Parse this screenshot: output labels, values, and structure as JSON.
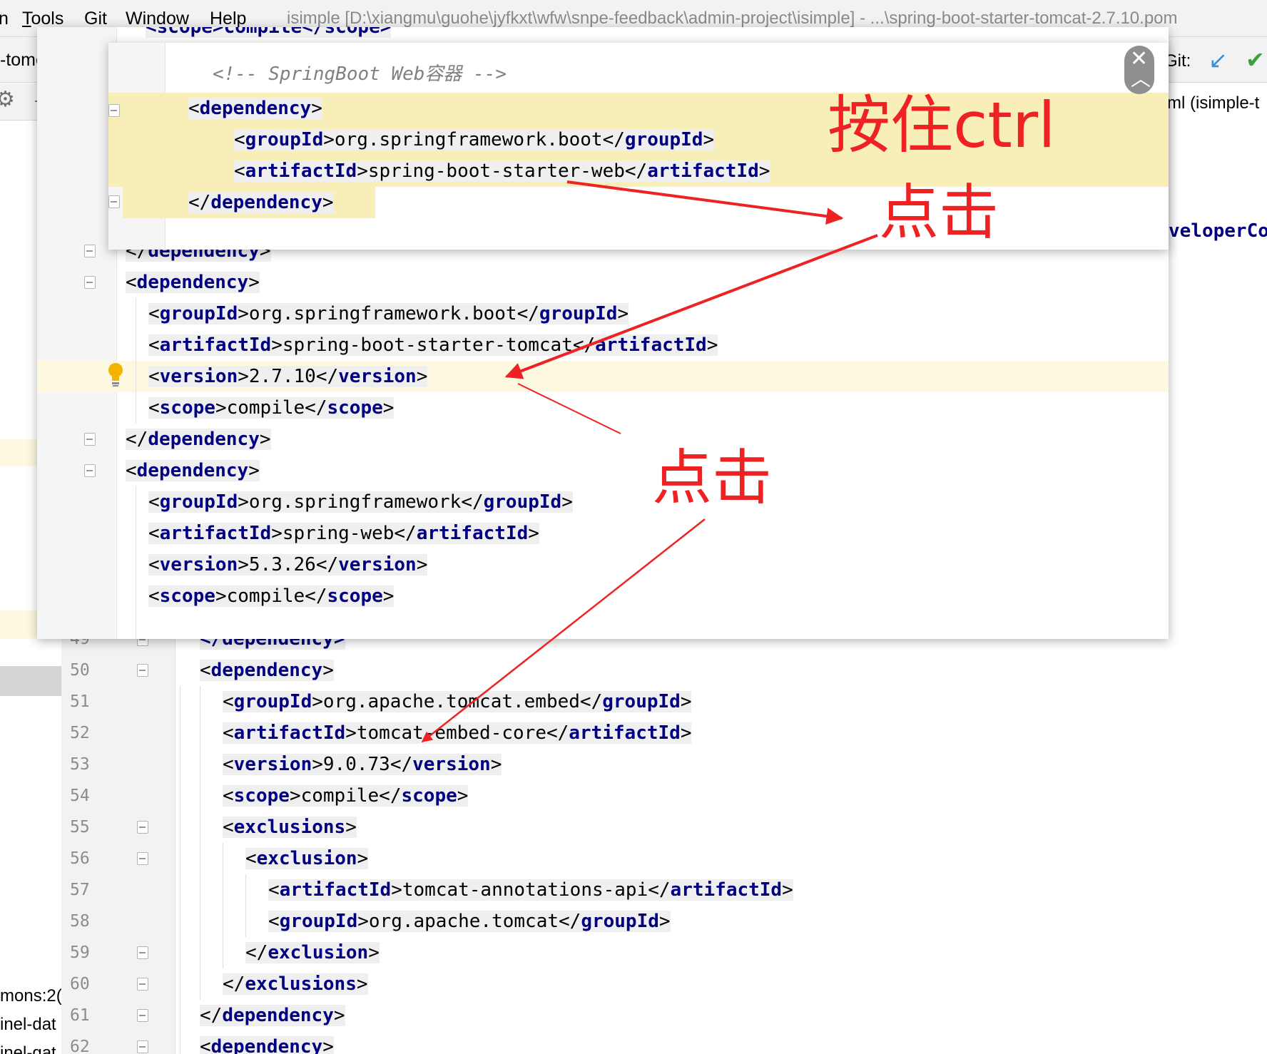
{
  "menubar": {
    "partial_item": "n",
    "items": [
      {
        "key": "tools",
        "mnemonic": "T",
        "rest": "ools"
      },
      {
        "key": "git",
        "mnemonic": "",
        "rest": "Git"
      },
      {
        "key": "window",
        "mnemonic": "",
        "rest": "Window"
      },
      {
        "key": "help",
        "mnemonic": "",
        "rest": "Help"
      }
    ],
    "window_title": "isimple [D:\\xiangmu\\guohe\\jyfkxt\\wfw\\snpe-feedback\\admin-project\\isimple] - ...\\spring-boot-starter-tomcat-2.7.10.pom"
  },
  "tabs": {
    "active_label": "-tome)",
    "close_icon": "×"
  },
  "toolbar": {
    "settings_icon": "gear-icon",
    "dash": "-"
  },
  "right_panel": {
    "git_label": "Git:",
    "git_update_icon": "checkmark-arrow-icon",
    "git_commit_icon": "checkmark-icon",
    "file_label": "ml (isimple-t",
    "code_fragment": "veloperCo"
  },
  "left_panel": {
    "fragments": [
      "mons:2(",
      "inel-dat",
      "inel-gat"
    ]
  },
  "popup1": {
    "comment": "<!-- SpringBoot Web容器 -->",
    "lines": [
      {
        "indent": 0,
        "open": "dependency",
        "text": "",
        "close": ""
      },
      {
        "indent": 1,
        "open": "groupId",
        "text": "org.springframework.boot",
        "close": "groupId"
      },
      {
        "indent": 1,
        "open": "artifactId",
        "text": "spring-boot-starter-web",
        "close": "artifactId"
      },
      {
        "indent": 0,
        "open": "",
        "text": "",
        "close": "dependency"
      }
    ]
  },
  "popup2": {
    "partial_line": "<scope>compile</scope>",
    "lines": [
      {
        "indent": 0,
        "open": "",
        "text": "",
        "close": "dependency"
      },
      {
        "indent": 0,
        "open": "dependency",
        "text": "",
        "close": ""
      },
      {
        "indent": 1,
        "open": "groupId",
        "text": "org.springframework.boot",
        "close": "groupId"
      },
      {
        "indent": 1,
        "open": "artifactId",
        "text": "spring-boot-starter-tomcat",
        "close": "artifactId"
      },
      {
        "indent": 1,
        "open": "version",
        "text": "2.7.10",
        "close": "version"
      },
      {
        "indent": 1,
        "open": "scope",
        "text": "compile",
        "close": "scope"
      },
      {
        "indent": 0,
        "open": "",
        "text": "",
        "close": "dependency"
      },
      {
        "indent": 0,
        "open": "dependency",
        "text": "",
        "close": ""
      },
      {
        "indent": 1,
        "open": "groupId",
        "text": "org.springframework",
        "close": "groupId"
      },
      {
        "indent": 1,
        "open": "artifactId",
        "text": "spring-web",
        "close": "artifactId"
      },
      {
        "indent": 1,
        "open": "version",
        "text": "5.3.26",
        "close": "version"
      },
      {
        "indent": 1,
        "open": "scope",
        "text": "compile",
        "close": "scope"
      }
    ],
    "bulb_icon": "lightbulb-icon"
  },
  "editor": {
    "partial_number": "49",
    "partial_line": "</dependency>",
    "lines": [
      {
        "num": "50",
        "indent": 0,
        "open": "dependency",
        "text": "",
        "close": ""
      },
      {
        "num": "51",
        "indent": 1,
        "open": "groupId",
        "text": "org.apache.tomcat.embed",
        "close": "groupId"
      },
      {
        "num": "52",
        "indent": 1,
        "open": "artifactId",
        "text": "tomcat-embed-core",
        "close": "artifactId"
      },
      {
        "num": "53",
        "indent": 1,
        "open": "version",
        "text": "9.0.73",
        "close": "version"
      },
      {
        "num": "54",
        "indent": 1,
        "open": "scope",
        "text": "compile",
        "close": "scope"
      },
      {
        "num": "55",
        "indent": 1,
        "open": "exclusions",
        "text": "",
        "close": ""
      },
      {
        "num": "56",
        "indent": 2,
        "open": "exclusion",
        "text": "",
        "close": ""
      },
      {
        "num": "57",
        "indent": 3,
        "open": "artifactId",
        "text": "tomcat-annotations-api",
        "close": "artifactId"
      },
      {
        "num": "58",
        "indent": 3,
        "open": "groupId",
        "text": "org.apache.tomcat",
        "close": "groupId"
      },
      {
        "num": "59",
        "indent": 2,
        "open": "",
        "text": "",
        "close": "exclusion"
      },
      {
        "num": "60",
        "indent": 1,
        "open": "",
        "text": "",
        "close": "exclusions"
      },
      {
        "num": "61",
        "indent": 0,
        "open": "",
        "text": "",
        "close": "dependency"
      },
      {
        "num": "62",
        "indent": 0,
        "open": "dependency",
        "text": "",
        "close": ""
      }
    ]
  },
  "annotations": {
    "hold_ctrl": "按住ctrl",
    "click_1": "点击",
    "click_2": "点击",
    "color": "#ee2222"
  }
}
